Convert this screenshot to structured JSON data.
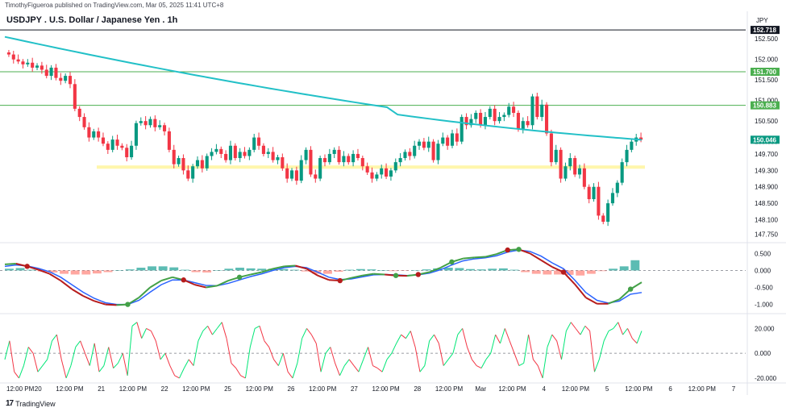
{
  "header": {
    "published_line": "TimothyFigueroa published on TradingView.com, Mar 05, 2025 11:41 UTC+8",
    "symbol_title": "USDJPY . U.S. Dollar / Japanese Yen . 1h",
    "currency": "JPY"
  },
  "branding": {
    "logo": "17",
    "name": "TradingView"
  },
  "colors": {
    "up": "#089981",
    "down": "#f23645",
    "ma": "#22c0c7",
    "hline": "#4caf50",
    "zone": "#fff59d",
    "macd_fast": "#2962ff",
    "osc_up": "#00e676",
    "osc_down": "#f23645"
  },
  "chart_data": [
    {
      "type": "candlestick",
      "panel": "price",
      "ylim": [
        147.6,
        152.72
      ],
      "y_ticks": [
        "152.500",
        "152.000",
        "151.500",
        "151.000",
        "150.500",
        "150.000",
        "149.700",
        "149.300",
        "148.900",
        "148.500",
        "148.100",
        "147.750"
      ],
      "x_ticks": [
        "12:00 PM",
        "20",
        "12:00 PM",
        "21",
        "12:00 PM",
        "22",
        "12:00 PM",
        "25",
        "12:00 PM",
        "26",
        "12:00 PM",
        "27",
        "12:00 PM",
        "28",
        "12:00 PM",
        "Mar",
        "12:00 PM",
        "4",
        "12:00 PM",
        "5",
        "12:00 PM",
        "6",
        "12:00 PM",
        "7"
      ],
      "closes": [
        152.12,
        152.0,
        151.95,
        151.88,
        151.92,
        151.8,
        151.85,
        151.75,
        151.6,
        151.8,
        151.55,
        151.48,
        151.6,
        151.4,
        150.8,
        150.6,
        150.35,
        150.1,
        150.25,
        150.1,
        149.95,
        149.8,
        150.05,
        149.9,
        149.85,
        149.62,
        149.9,
        150.45,
        150.5,
        150.4,
        150.55,
        150.35,
        150.4,
        150.25,
        149.8,
        149.45,
        149.6,
        149.3,
        149.1,
        149.4,
        149.55,
        149.35,
        149.65,
        149.75,
        149.82,
        149.7,
        149.55,
        149.9,
        149.6,
        149.75,
        149.65,
        149.8,
        150.1,
        149.9,
        149.7,
        149.75,
        149.55,
        149.62,
        149.35,
        149.1,
        149.3,
        149.05,
        149.55,
        149.8,
        149.2,
        149.1,
        149.6,
        149.5,
        149.7,
        149.8,
        149.5,
        149.65,
        149.5,
        149.7,
        149.6,
        149.4,
        149.25,
        149.1,
        149.2,
        149.35,
        149.15,
        149.3,
        149.5,
        149.6,
        149.75,
        149.65,
        149.9,
        150.0,
        149.85,
        150.0,
        149.55,
        149.95,
        150.1,
        149.9,
        150.2,
        150.0,
        150.6,
        150.4,
        150.55,
        150.7,
        150.4,
        150.6,
        150.8,
        150.5,
        150.6,
        150.65,
        150.85,
        150.7,
        150.3,
        150.5,
        150.4,
        151.1,
        150.6,
        150.9,
        150.2,
        149.5,
        149.8,
        149.1,
        149.4,
        149.6,
        149.2,
        149.35,
        148.9,
        148.6,
        148.9,
        148.2,
        148.05,
        148.5,
        148.75,
        149.0,
        149.5,
        149.8,
        150.0,
        150.1,
        150.046
      ],
      "sma": {
        "color": "#22c0c7",
        "start": 152.55,
        "end": 150.046
      },
      "price_labels": [
        {
          "value": 152.718,
          "label": "152.718",
          "color": "#131722"
        },
        {
          "value": 151.7,
          "label": "151.700",
          "color": "#4caf50"
        },
        {
          "value": 150.883,
          "label": "150.883",
          "color": "#4caf50"
        },
        {
          "value": 150.046,
          "label": "150.046",
          "color": "#089981"
        }
      ],
      "horizontal_lines": [
        152.718,
        151.7,
        150.883
      ],
      "support_zone": [
        149.34,
        149.42
      ]
    },
    {
      "type": "line",
      "panel": "macd",
      "ylim": [
        -1.2,
        0.65
      ],
      "y_ticks": [
        "0.500",
        "0.000",
        "-0.500",
        "-1.000"
      ],
      "series": [
        {
          "values": [
            0.18,
            0.2,
            0.12,
            0.02,
            -0.1,
            -0.3,
            -0.55,
            -0.75,
            -0.9,
            -1.0,
            -1.02,
            -1.0,
            -0.8,
            -0.5,
            -0.3,
            -0.2,
            -0.28,
            -0.42,
            -0.5,
            -0.45,
            -0.3,
            -0.2,
            -0.12,
            -0.05,
            0.05,
            0.12,
            0.14,
            0.05,
            -0.15,
            -0.28,
            -0.3,
            -0.22,
            -0.15,
            -0.1,
            -0.12,
            -0.15,
            -0.16,
            -0.12,
            -0.05,
            0.08,
            0.25,
            0.35,
            0.38,
            0.4,
            0.48,
            0.6,
            0.62,
            0.5,
            0.3,
            0.1,
            -0.05,
            -0.4,
            -0.8,
            -0.98,
            -0.98,
            -0.85,
            -0.55,
            -0.35
          ]
        },
        {
          "values": [
            0.12,
            0.16,
            0.13,
            0.06,
            -0.04,
            -0.2,
            -0.42,
            -0.64,
            -0.82,
            -0.95,
            -1.0,
            -1.0,
            -0.88,
            -0.64,
            -0.42,
            -0.28,
            -0.28,
            -0.36,
            -0.44,
            -0.45,
            -0.38,
            -0.28,
            -0.18,
            -0.1,
            0.0,
            0.08,
            0.12,
            0.08,
            -0.05,
            -0.2,
            -0.27,
            -0.25,
            -0.19,
            -0.13,
            -0.12,
            -0.13,
            -0.15,
            -0.13,
            -0.08,
            0.02,
            0.16,
            0.28,
            0.34,
            0.37,
            0.43,
            0.54,
            0.6,
            0.56,
            0.42,
            0.22,
            0.05,
            -0.28,
            -0.65,
            -0.88,
            -0.96,
            -0.9,
            -0.7,
            -0.65
          ]
        }
      ],
      "histogram": [
        0.05,
        0.07,
        0.02,
        -0.03,
        -0.06,
        -0.1,
        -0.12,
        -0.12,
        -0.09,
        -0.05,
        0.0,
        0.03,
        0.08,
        0.12,
        0.12,
        0.09,
        0.02,
        -0.05,
        -0.06,
        0.0,
        0.05,
        0.08,
        0.06,
        0.05,
        0.05,
        0.04,
        0.02,
        -0.03,
        -0.1,
        -0.1,
        -0.04,
        0.02,
        0.04,
        0.03,
        0.0,
        -0.02,
        -0.01,
        0.01,
        0.03,
        0.06,
        0.08,
        0.07,
        0.04,
        0.03,
        0.05,
        0.06,
        0.02,
        -0.05,
        -0.1,
        -0.12,
        -0.12,
        -0.13,
        -0.15,
        -0.1,
        -0.02,
        0.05,
        0.12,
        0.3
      ],
      "cross_markers": [
        {
          "i": 2,
          "up": false
        },
        {
          "i": 11,
          "up": true
        },
        {
          "i": 16,
          "up": false
        },
        {
          "i": 21,
          "up": true
        },
        {
          "i": 30,
          "up": false
        },
        {
          "i": 35,
          "up": true
        },
        {
          "i": 37,
          "up": false
        },
        {
          "i": 40,
          "up": true
        },
        {
          "i": 45,
          "up": false
        },
        {
          "i": 46,
          "up": true
        },
        {
          "i": 50,
          "up": false
        },
        {
          "i": 56,
          "up": true
        }
      ]
    },
    {
      "type": "line",
      "panel": "oscillator",
      "ylim": [
        -22,
        30
      ],
      "y_ticks": [
        "20.000",
        "0.000",
        "-20.000"
      ],
      "values": [
        -5,
        10,
        -15,
        -20,
        -10,
        5,
        0,
        -15,
        -10,
        -5,
        10,
        15,
        -5,
        -20,
        -10,
        5,
        10,
        0,
        -10,
        8,
        -15,
        -10,
        5,
        -12,
        -8,
        0,
        -18,
        22,
        25,
        12,
        20,
        18,
        10,
        -5,
        0,
        -10,
        -18,
        -20,
        -12,
        -5,
        -10,
        10,
        18,
        22,
        15,
        20,
        25,
        12,
        -8,
        -12,
        -18,
        -20,
        5,
        20,
        22,
        10,
        5,
        -5,
        -10,
        0,
        -15,
        -20,
        -8,
        12,
        20,
        15,
        8,
        -15,
        0,
        5,
        -8,
        -18,
        -10,
        -5,
        -10,
        -15,
        -5,
        5,
        -10,
        -12,
        -15,
        -5,
        0,
        8,
        15,
        12,
        18,
        5,
        -15,
        -10,
        10,
        15,
        8,
        -10,
        -5,
        0,
        15,
        20,
        5,
        -5,
        -10,
        -12,
        -5,
        0,
        15,
        8,
        20,
        10,
        0,
        -10,
        -8,
        15,
        -5,
        -10,
        -20,
        5,
        15,
        10,
        -5,
        18,
        25,
        20,
        15,
        22,
        18,
        -15,
        -5,
        10,
        18,
        20,
        25,
        15,
        20,
        12,
        8,
        18
      ]
    }
  ]
}
